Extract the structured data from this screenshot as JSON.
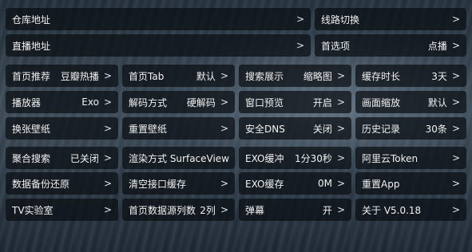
{
  "top_rows": [
    {
      "label": "仓库地址",
      "value": ""
    },
    {
      "label": "线路切换",
      "value": ""
    },
    {
      "label": "直播地址",
      "value": ""
    },
    {
      "label": "首选项",
      "value": "点播"
    }
  ],
  "grid": [
    [
      {
        "label": "首页推荐",
        "value": "豆瓣热播"
      },
      {
        "label": "首页Tab",
        "value": "默认"
      },
      {
        "label": "搜索展示",
        "value": "缩略图"
      },
      {
        "label": "缓存时长",
        "value": "3天"
      }
    ],
    [
      {
        "label": "播放器",
        "value": "Exo"
      },
      {
        "label": "解码方式",
        "value": "硬解码"
      },
      {
        "label": "窗口预览",
        "value": "开启"
      },
      {
        "label": "画面缩放",
        "value": "默认"
      }
    ],
    [
      {
        "label": "换张壁纸",
        "value": ""
      },
      {
        "label": "重置壁纸",
        "value": ""
      },
      {
        "label": "安全DNS",
        "value": "关闭"
      },
      {
        "label": "历史记录",
        "value": "30条"
      }
    ],
    [
      {
        "label": "聚合搜索",
        "value": "已关闭"
      },
      {
        "label": "渲染方式 SurfaceView",
        "value": ""
      },
      {
        "label": "EXO缓冲",
        "value": "1分30秒"
      },
      {
        "label": "阿里云Token",
        "value": ""
      }
    ],
    [
      {
        "label": "数据备份还原",
        "value": ""
      },
      {
        "label": "清空接口缓存",
        "value": ""
      },
      {
        "label": "EXO缓存",
        "value": "0M"
      },
      {
        "label": "重置App",
        "value": ""
      }
    ],
    [
      {
        "label": "TV实验室",
        "value": ""
      },
      {
        "label": "首页数据源列数",
        "value": "2列"
      },
      {
        "label": "弹幕",
        "value": "开"
      },
      {
        "label": "关于  V5.0.18",
        "value": ""
      }
    ]
  ],
  "chevron": ">"
}
